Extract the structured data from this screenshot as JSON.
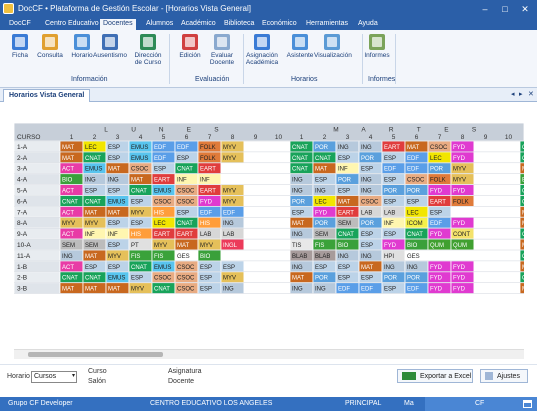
{
  "window": {
    "title": "DocCF • Plataforma de Gestión Escolar  - [Horarios Vista General]",
    "minimize": "–",
    "maximize": "□",
    "close": "✕"
  },
  "menu": [
    "DocCF",
    "Centro Educativo",
    "Docentes",
    "Alumnos",
    "Académico",
    "Biblioteca",
    "Económico",
    "Herramientas",
    "Ayuda"
  ],
  "menu_active": 2,
  "ribbon": {
    "buttons": [
      {
        "label": "Ficha",
        "icon": "id-card-icon",
        "color": "#3a7bd5"
      },
      {
        "label": "Consulta",
        "icon": "magnifier-icon",
        "color": "#e0a030"
      },
      {
        "label": "Horario",
        "icon": "calendar-icon",
        "color": "#4a8fd8"
      },
      {
        "label": "Ausentismo",
        "icon": "teacher-icon",
        "color": "#3f6fb5"
      },
      {
        "label": "Dirección\nde Curso",
        "icon": "person-arrow-icon",
        "color": "#2e8b57"
      },
      {
        "label": "Edición",
        "icon": "list-edit-icon",
        "color": "#d04040"
      },
      {
        "label": "Evaluar\nDocente",
        "icon": "evaluation-icon",
        "color": "#8aa9cf"
      },
      {
        "label": "Asignación\nAcadémica",
        "icon": "assignment-icon",
        "color": "#3a7bd5"
      },
      {
        "label": "Asistente",
        "icon": "wizard-icon",
        "color": "#4a8fd8"
      },
      {
        "label": "Visualización",
        "icon": "display-icon",
        "color": "#5b9bd5"
      },
      {
        "label": "Informes",
        "icon": "report-icon",
        "color": "#7ba35a"
      }
    ],
    "groups": [
      "Información",
      "Evaluación",
      "Horarios",
      "Informes"
    ]
  },
  "tab": {
    "label": "Horarios Vista General",
    "prev": "◂",
    "next": "▸",
    "close": "✕"
  },
  "schedule": {
    "corner": "CURSO",
    "days": [
      {
        "name": "LUNES"
      },
      {
        "name": "MARTES"
      },
      {
        "name": "MIÉRCOLES"
      }
    ],
    "periods": [
      "1",
      "2",
      "3",
      "4",
      "5",
      "6",
      "7",
      "8",
      "9",
      "10"
    ],
    "courses": [
      "1-A",
      "2-A",
      "3-A",
      "4-A",
      "5-A",
      "6-A",
      "7-A",
      "8-A",
      "9-A",
      "10-A",
      "11-A",
      "1-B",
      "2-B",
      "3-B"
    ],
    "colors": {
      "MAT": "#c8681f",
      "LEC": "#f2e600",
      "ESP": "#bcd3e8",
      "EMUS": "#58c4ee",
      "EDF": "#5a9ee8",
      "FOLK": "#e07b3a",
      "MYV": "#e5c05a",
      "CNAT": "#18a35a",
      "POR": "#5aa0dd",
      "ING": "#b6c9dc",
      "EART": "#e03d3d",
      "CSOC": "#e8ab82",
      "FYD": "#e03ad0",
      "ACT": "#e83ca6",
      "BIO": "#3aa03a",
      "INF": "#fff6b0",
      "LAB": "#d7d7d7",
      "FIS": "#3aa23a",
      "CONT": "#f4e26a",
      "SEM": "#bcbcbc",
      "PT": "#e0e0e0",
      "QUM": "#40a030",
      "INGL": "#ec3a5a",
      "ICOM": "#f4f04a",
      "HIS": "#ff9d3a",
      "BLAB": "#a79b9b",
      "GES": "#ffffff",
      "HPI": "#e0e0e0",
      "_default": "#e8e8e8"
    },
    "rows": [
      [
        [
          "MAT",
          "LEC",
          "ESP",
          "EMUS",
          "EDF",
          "EDF",
          "FOLK",
          "MYV",
          "",
          ""
        ],
        [
          "CNAT",
          "POR",
          "ING",
          "ING",
          "EART",
          "MAT",
          "CSOC",
          "FYD",
          "",
          ""
        ],
        [
          "CNAT"
        ]
      ],
      [
        [
          "MAT",
          "CNAT",
          "ESP",
          "EMUS",
          "EDF",
          "ESP",
          "FOLK",
          "MYV",
          "",
          ""
        ],
        [
          "CNAT",
          "CNAT",
          "ESP",
          "POR",
          "ESP",
          "EDF",
          "LEC",
          "FYD",
          "",
          ""
        ],
        [
          "CNAT"
        ]
      ],
      [
        [
          "ACT",
          "EMUS",
          "MAT",
          "CSOC",
          "ESP",
          "CNAT",
          "EART",
          "",
          "",
          ""
        ],
        [
          "CNAT",
          "MAT",
          "INF",
          "ESP",
          "EDF",
          "EDF",
          "POR",
          "MYV",
          "",
          ""
        ],
        [
          "MAT"
        ]
      ],
      [
        [
          "BIO",
          "ING",
          "ING",
          "MAT",
          "EART",
          "INF",
          "INF",
          "",
          "",
          ""
        ],
        [
          "ING",
          "ESP",
          "POR",
          "ING",
          "ESP",
          "CSOC",
          "FOLK",
          "MYV",
          "",
          ""
        ],
        [
          "BIO"
        ]
      ],
      [
        [
          "ACT",
          "ESP",
          "ESP",
          "CNAT",
          "EMUS",
          "CSOC",
          "EART",
          "MYV",
          "",
          ""
        ],
        [
          "ING",
          "ING",
          "ESP",
          "ING",
          "POR",
          "POR",
          "FYD",
          "FYD",
          "",
          ""
        ],
        [
          "CNAT"
        ]
      ],
      [
        [
          "CNAT",
          "CNAT",
          "EMUS",
          "ESP",
          "CSOC",
          "CSOC",
          "FYD",
          "MYV",
          "",
          ""
        ],
        [
          "POR",
          "LEC",
          "MAT",
          "CSOC",
          "ESP",
          "ESP",
          "EART",
          "FOLK",
          "",
          ""
        ],
        [
          "CNAT"
        ]
      ],
      [
        [
          "ACT",
          "MAT",
          "MAT",
          "MYV",
          "HIS",
          "ESP",
          "EDF",
          "EDF",
          "",
          ""
        ],
        [
          "ESP",
          "FYD",
          "EART",
          "LAB",
          "LAB",
          "LEC",
          "ESP",
          "",
          "",
          ""
        ],
        [
          "MAT"
        ]
      ],
      [
        [
          "MYV",
          "MYV",
          "ESP",
          "ESP",
          "LEC",
          "CNAT",
          "HIS",
          "ING",
          "",
          ""
        ],
        [
          "MAT",
          "POR",
          "SEM",
          "POR",
          "INF",
          "ICOM",
          "EDF",
          "FYD",
          "",
          ""
        ],
        [
          "MAT"
        ]
      ],
      [
        [
          "ACT",
          "INF",
          "INF",
          "HIS",
          "EART",
          "EART",
          "LAB",
          "LAB",
          "",
          ""
        ],
        [
          "ING",
          "SEM",
          "CNAT",
          "ESP",
          "ESP",
          "CNAT",
          "FYD",
          "CONT",
          "",
          ""
        ],
        [
          "CNAT"
        ]
      ],
      [
        [
          "SEM",
          "SEM",
          "ESP",
          "PT",
          "MYV",
          "MAT",
          "MYV",
          "INGL",
          "",
          ""
        ],
        [
          "TIS",
          "FIS",
          "BIO",
          "ESP",
          "FYD",
          "BIO",
          "QUM",
          "QUM",
          "",
          ""
        ],
        [
          "MAT"
        ]
      ],
      [
        [
          "ING",
          "MAT",
          "MYV",
          "FIS",
          "FIS",
          "GES",
          "BIO",
          "",
          "",
          ""
        ],
        [
          "BLAB",
          "BLAB",
          "ING",
          "ING",
          "HPI",
          "GES",
          "",
          "",
          "",
          ""
        ],
        [
          "CNAT"
        ]
      ],
      [
        [
          "ACT",
          "ESP",
          "ESP",
          "CNAT",
          "EMUS",
          "CSOC",
          "ESP",
          "ESP",
          "",
          ""
        ],
        [
          "ING",
          "ESP",
          "ESP",
          "MAT",
          "ING",
          "ING",
          "FYD",
          "FYD",
          "",
          ""
        ],
        [
          "MAT"
        ]
      ],
      [
        [
          "CNAT",
          "CNAT",
          "EMUS",
          "ESP",
          "CSOC",
          "CSOC",
          "ESP",
          "MYV",
          "",
          ""
        ],
        [
          "MAT",
          "POR",
          "ESP",
          "ESP",
          "POR",
          "POR",
          "FYD",
          "FYD",
          "",
          ""
        ],
        [
          "CNAT"
        ]
      ],
      [
        [
          "MAT",
          "MAT",
          "MAT",
          "MYV",
          "CNAT",
          "CSOC",
          "ESP",
          "ING",
          "",
          ""
        ],
        [
          "ING",
          "ING",
          "EDF",
          "EDF",
          "ESP",
          "EDF",
          "FYD",
          "FYD",
          "",
          ""
        ],
        [
          "MAT"
        ]
      ]
    ]
  },
  "bottom": {
    "horario_label": "Horario",
    "horario_value": "Cursos",
    "select_arrow": "▾",
    "curso": "Curso",
    "salon": "Salón",
    "asignatura": "Asignatura",
    "docente": "Docente",
    "export_label": "Exportar a Excel",
    "export_color": "#2e8b3a",
    "ajustes_label": "Ajustes",
    "ajustes_color": "#9fb6d6"
  },
  "status": {
    "group": "Grupo CF Developer",
    "center": "CENTRO EDUCATIVO LOS ANGELES",
    "mode": "PRINCIPAL",
    "user": "Ma",
    "tag": "CF",
    "calendar": "calendar-icon"
  }
}
